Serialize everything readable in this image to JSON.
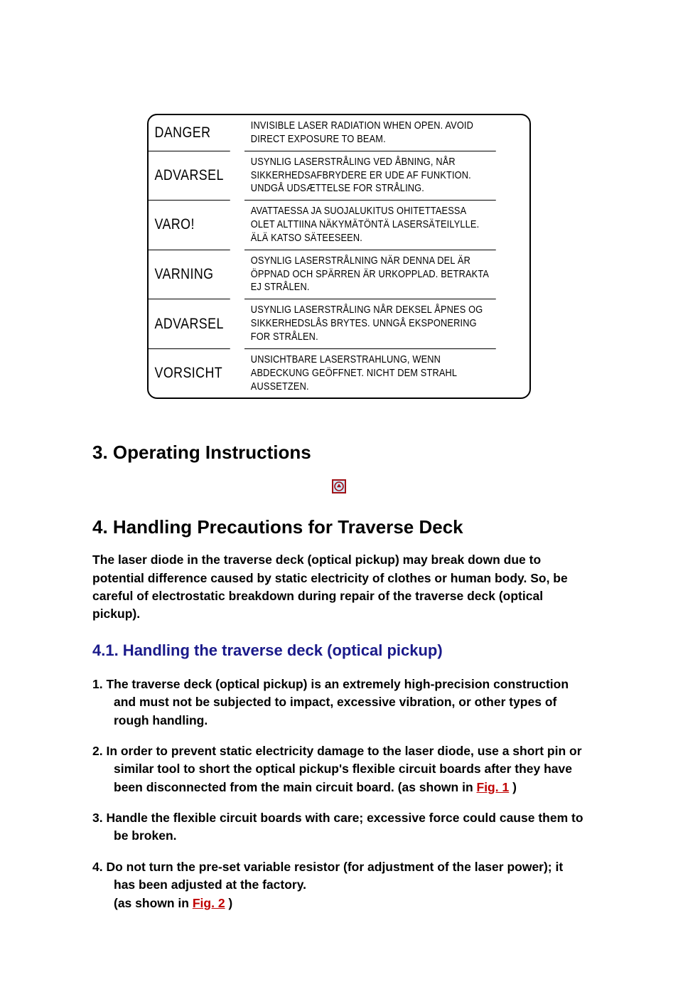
{
  "warnings": [
    {
      "label": "DANGER",
      "msg": "INVISIBLE LASER RADIATION WHEN OPEN. AVOID DIRECT EXPOSURE TO BEAM."
    },
    {
      "label": "ADVARSEL",
      "msg": "USYNLIG LASERSTRÅLING VED ÅBNING, NÅR SIKKERHEDSAFBRYDERE ER UDE AF FUNKTION. UNDGÅ UDSÆTTELSE FOR STRÅLING."
    },
    {
      "label": "VARO!",
      "msg": "AVATTAESSA JA SUOJALUKITUS OHITETTAESSA OLET ALTTIINA NÄKYMÄTÖNTÄ LASERSÄTEILYLLE.  ÄLÄ KATSO SÄTEESEEN."
    },
    {
      "label": "VARNING",
      "msg": "OSYNLIG LASERSTRÅLNING NÄR DENNA DEL ÄR ÖPPNAD OCH SPÄRREN ÄR URKOPPLAD.  BETRAKTA EJ STRÅLEN."
    },
    {
      "label": "ADVARSEL",
      "msg": "USYNLIG LASERSTRÅLING NÅR DEKSEL ÅPNES OG SIKKERHEDSLÅS BRYTES.  UNNGÅ EKSPONERING FOR STRÅLEN."
    },
    {
      "label": "VORSICHT",
      "msg": "UNSICHTBARE LASERSTRAHLUNG, WENN ABDECKUNG GEÖFFNET. NICHT DEM STRAHL AUSSETZEN."
    }
  ],
  "section3_title": "3. Operating Instructions",
  "section4_title": "4. Handling Precautions for Traverse Deck",
  "section4_intro": "The laser diode in the traverse deck (optical pickup) may break down due to potential difference caused by static electricity of clothes or human body. So, be careful of electrostatic breakdown during repair of the traverse deck (optical pickup).",
  "section4_1_title": "4.1. Handling the traverse deck (optical pickup)",
  "list": {
    "i1": "1. The traverse deck (optical pickup) is an extremely high-precision construction and must not be subjected to impact, excessive vibration, or other types of rough handling.",
    "i2a": "2. In order to prevent static electricity damage to the laser diode, use a short pin or similar tool to short the optical pickup's flexible circuit boards after they have been disconnected from the main circuit board. (as shown in ",
    "i2_link": "Fig. 1",
    "i2b": " )",
    "i3": "3. Handle the flexible circuit boards with care; excessive force could cause them to be broken.",
    "i4a": "4. Do not turn the pre-set variable resistor (for adjustment of the laser power); it has been adjusted at the factory.",
    "i4b": "(as shown in ",
    "i4_link": "Fig. 2",
    "i4c": " )"
  }
}
